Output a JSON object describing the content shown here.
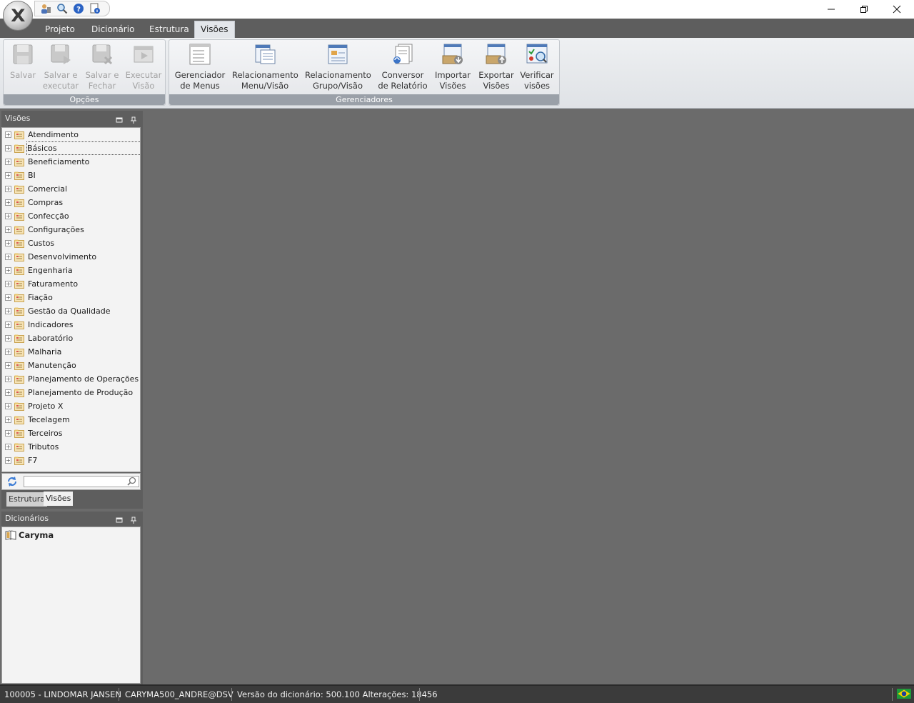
{
  "quick_access": {
    "icons": [
      "user-config-icon",
      "zoom-icon",
      "help-icon",
      "document-info-icon"
    ]
  },
  "window_controls": {
    "minimize": "minimize-icon",
    "restore": "restore-icon",
    "close": "close-icon"
  },
  "ribbon_tabs": [
    {
      "label": "Projeto",
      "active": false
    },
    {
      "label": "Dicionário",
      "active": false
    },
    {
      "label": "Estrutura",
      "active": false
    },
    {
      "label": "Visões",
      "active": true
    }
  ],
  "ribbon": {
    "groups": [
      {
        "label": "Opções",
        "buttons": [
          {
            "line1": "Salvar",
            "line2": "",
            "icon": "save-icon",
            "enabled": false
          },
          {
            "line1": "Salvar e",
            "line2": "executar",
            "icon": "save-execute-icon",
            "enabled": false
          },
          {
            "line1": "Salvar e",
            "line2": "Fechar",
            "icon": "save-close-icon",
            "enabled": false
          },
          {
            "line1": "Executar",
            "line2": "Visão",
            "icon": "execute-view-icon",
            "enabled": false
          }
        ]
      },
      {
        "label": "Gerenciadores",
        "buttons": [
          {
            "line1": "Gerenciador",
            "line2": "de Menus",
            "icon": "menu-manager-icon",
            "enabled": true
          },
          {
            "line1": "Relacionamento",
            "line2": "Menu/Visão",
            "icon": "menu-view-relation-icon",
            "enabled": true
          },
          {
            "line1": "Relacionamento",
            "line2": "Grupo/Visão",
            "icon": "group-view-relation-icon",
            "enabled": true
          },
          {
            "line1": "Conversor",
            "line2": "de Relatório",
            "icon": "report-converter-icon",
            "enabled": true
          },
          {
            "line1": "Importar",
            "line2": "Visões",
            "icon": "import-views-icon",
            "enabled": true
          },
          {
            "line1": "Exportar",
            "line2": "Visões",
            "icon": "export-views-icon",
            "enabled": true
          },
          {
            "line1": "Verificar",
            "line2": "visões",
            "icon": "verify-views-icon",
            "enabled": true
          }
        ]
      }
    ]
  },
  "visoes_panel": {
    "title": "Visões",
    "items": [
      "Atendimento",
      "Básicos",
      "Beneficiamento",
      "BI",
      "Comercial",
      "Compras",
      "Confecção",
      "Configurações",
      "Custos",
      "Desenvolvimento",
      "Engenharia",
      "Faturamento",
      "Fiação",
      "Gestão da Qualidade",
      "Indicadores",
      "Laboratório",
      "Malharia",
      "Manutenção",
      "Planejamento de Operações e Ve",
      "Planejamento de Produção",
      "Projeto X",
      "Tecelagem",
      "Terceiros",
      "Tributos",
      "F7"
    ],
    "selected_item": "Básicos",
    "search_value": "",
    "tabs": [
      {
        "label": "Estrutura",
        "active": false
      },
      {
        "label": "Visões",
        "active": true
      }
    ]
  },
  "dicionarios_panel": {
    "title": "Dicionários",
    "items": [
      "Caryma"
    ]
  },
  "status_bar": {
    "user": "100005 - LINDOMAR JANSEN",
    "connection": "CARYMA500_ANDRE@DSV",
    "version": "Versão do dicionário: 500.100 Alterações: 18456",
    "flag_icon": "brazil-flag-icon"
  },
  "colors": {
    "workspace": "#6b6b6b",
    "tabstrip": "#5e5e5e",
    "statusbar": "#3b3b3b",
    "brazil_green": "#1e9a3a",
    "brazil_yellow": "#f5d000",
    "brazil_blue": "#1f3f9a"
  }
}
